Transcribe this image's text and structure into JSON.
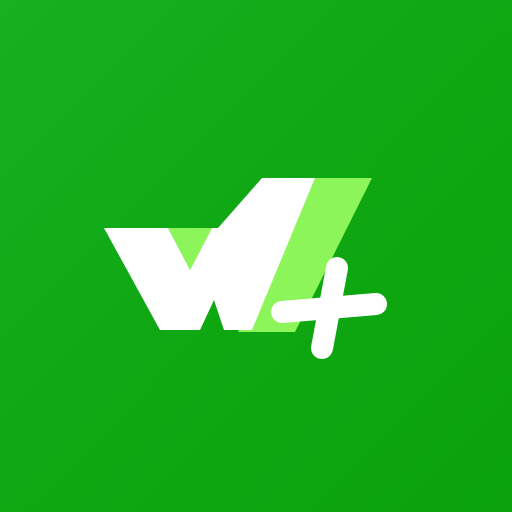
{
  "icon": {
    "name": "app-logo",
    "colors": {
      "background": "#0EA712",
      "primary_mark": "#FFFFFF",
      "accent_mark": "#8CF55A"
    }
  }
}
